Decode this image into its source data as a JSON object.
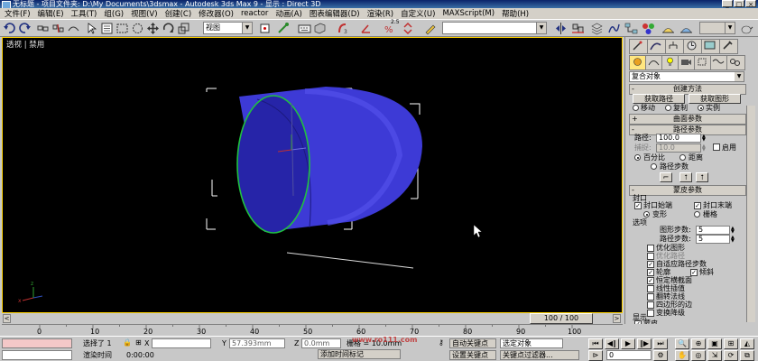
{
  "title_bar": {
    "text": "无标题    - 项目文件夹: D:\\My Documents\\3dsmax    - Autodesk 3ds Max 9    - 显示 : Direct 3D",
    "buttons": [
      "_",
      "□",
      "×"
    ]
  },
  "menu": [
    "文件(F)",
    "编辑(E)",
    "工具(T)",
    "组(G)",
    "视图(V)",
    "创建(C)",
    "修改器(O)",
    "reactor",
    "动画(A)",
    "图表编辑器(D)",
    "渲染(R)",
    "自定义(U)",
    "MAXScript(M)",
    "帮助(H)"
  ],
  "toolbar": {
    "view_dropdown": "视图",
    "snap_value": "2.5",
    "selection_set": ""
  },
  "viewport": {
    "label": "透视 | 禁用"
  },
  "command_panel": {
    "category_dropdown": "复合对象",
    "creation_method": {
      "header": "创建方法",
      "get_path": "获取路径",
      "get_shape": "获取图形",
      "modes": [
        "移动",
        "复制",
        "实例"
      ]
    },
    "surface_params": {
      "header": "曲面参数"
    },
    "path_params": {
      "header": "路径参数",
      "path_label": "路径:",
      "path_value": "100.0",
      "snap_label": "捕捉:",
      "snap_value": "10.0",
      "enable": "启用",
      "percent": "百分比",
      "distance": "距离",
      "path_steps": "路径步数"
    },
    "skin_params": {
      "header": "蒙皮参数",
      "capping": "封口",
      "cap_start": "封口始端",
      "cap_end": "封口末端",
      "morph": "变形",
      "grid": "栅格",
      "options": "选项",
      "shape_steps_label": "图形步数:",
      "shape_steps": "5",
      "path_steps_label": "路径步数:",
      "path_steps": "5",
      "checkboxes": [
        {
          "label": "优化图形",
          "checked": false,
          "dim": false
        },
        {
          "label": "优化路径",
          "checked": false,
          "dim": true
        },
        {
          "label": "自适应路径步数",
          "checked": true,
          "dim": false
        },
        {
          "label": "轮廓",
          "checked": true,
          "dim": false
        },
        {
          "label": "倾斜",
          "checked": true,
          "dim": false
        },
        {
          "label": "恒定横截面",
          "checked": true,
          "dim": false
        },
        {
          "label": "线性插值",
          "checked": false,
          "dim": false
        },
        {
          "label": "翻转法线",
          "checked": false,
          "dim": false
        },
        {
          "label": "四边形的边",
          "checked": false,
          "dim": false
        },
        {
          "label": "变换降级",
          "checked": false,
          "dim": false
        }
      ],
      "display": "显示",
      "skin": "蒙皮"
    }
  },
  "timeline": {
    "slider_label": "100 / 100",
    "ticks": [
      "0",
      "10",
      "20",
      "30",
      "40",
      "50",
      "60",
      "70",
      "80",
      "90",
      "100"
    ]
  },
  "status": {
    "selected": "选择了 1",
    "x_label": "X",
    "x_value": "",
    "y_label": "Y",
    "y_value": "57.393mm",
    "z_label": "Z",
    "z_value": "0.0mm",
    "grid_label": "栅格 = 10.0mm",
    "render_time_label": "渲染时间",
    "render_time": "0:00:00",
    "add_time_tag": "添加时间标记",
    "auto_key": "自动关键点",
    "selected_object": "选定对象",
    "set_key": "设置关键点",
    "key_filters": "关键点过滤器...",
    "watermark": "www.ro111.com",
    "frame_field": "0"
  },
  "colors": {
    "viewport_border": "#ffd200",
    "object": "#3d3ad6",
    "selection": "#20c040",
    "titlebar": "#0a246a"
  }
}
